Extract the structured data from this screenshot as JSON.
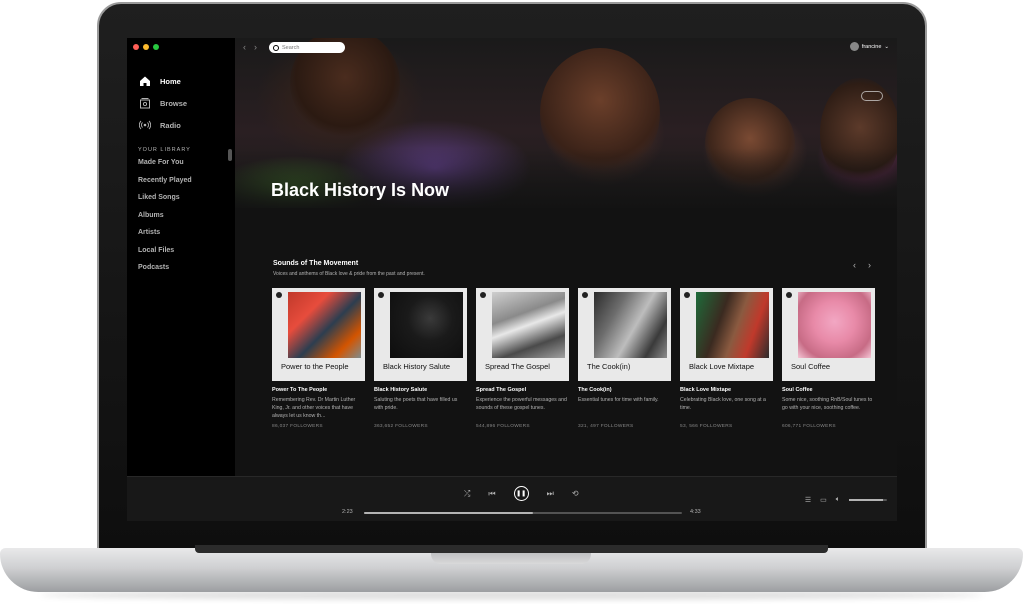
{
  "window": {
    "controls": [
      "close",
      "minimize",
      "maximize"
    ]
  },
  "sidebar": {
    "nav": [
      {
        "label": "Home",
        "icon": "home-icon",
        "active": true
      },
      {
        "label": "Browse",
        "icon": "browse-icon",
        "active": false
      },
      {
        "label": "Radio",
        "icon": "radio-icon",
        "active": false
      }
    ],
    "library_title": "YOUR LIBRARY",
    "library": [
      "Made For You",
      "Recently Played",
      "Liked Songs",
      "Albums",
      "Artists",
      "Local Files",
      "Podcasts"
    ]
  },
  "topbar": {
    "search_placeholder": "Search",
    "username": "francine"
  },
  "hero": {
    "title": "Black History Is Now"
  },
  "section": {
    "title": "Sounds of The Movement",
    "subtitle": "Voices and anthems of Black love & pride from the past and present."
  },
  "cards": [
    {
      "cover_label": "Power to the People",
      "title": "Power To The People",
      "desc": "Remembering Rev. Dr Martin Luther King, Jr. and other voices that have always let us know th...",
      "followers": "86,037 FOLLOWERS"
    },
    {
      "cover_label": "Black History Salute",
      "title": "Black History Salute",
      "desc": "Saluting the poets that have filled us with pride.",
      "followers": "363,652 FOLLOWERS"
    },
    {
      "cover_label": "Spread The Gospel",
      "title": "Spread The Gospel",
      "desc": "Experience the powerful messages and sounds of these gospel tunes.",
      "followers": "544,896 FOLLOWERS"
    },
    {
      "cover_label": "The Cook(in)",
      "title": "The Cook(in)",
      "desc": "Essential tunes for time with family.",
      "followers": "321, 497 FOLLOWERS"
    },
    {
      "cover_label": "Black Love Mixtape",
      "title": "Black Love Mixtape",
      "desc": "Celebrating Black love, one song at a time.",
      "followers": "53, 566 FOLLOWERS"
    },
    {
      "cover_label": "Soul Coffee",
      "title": "Soul Coffee",
      "desc": "Some nice, soothing RnB/Soul tunes to go with your nice, soothing coffee.",
      "followers": "606,771 FOLLOWERS"
    }
  ],
  "player": {
    "elapsed": "2:23",
    "duration": "4:33",
    "progress": 0.53,
    "volume": 0.9
  },
  "colors": {
    "accent": "#1db954",
    "background": "#121212",
    "sidebar": "#000000",
    "player": "#181818"
  }
}
